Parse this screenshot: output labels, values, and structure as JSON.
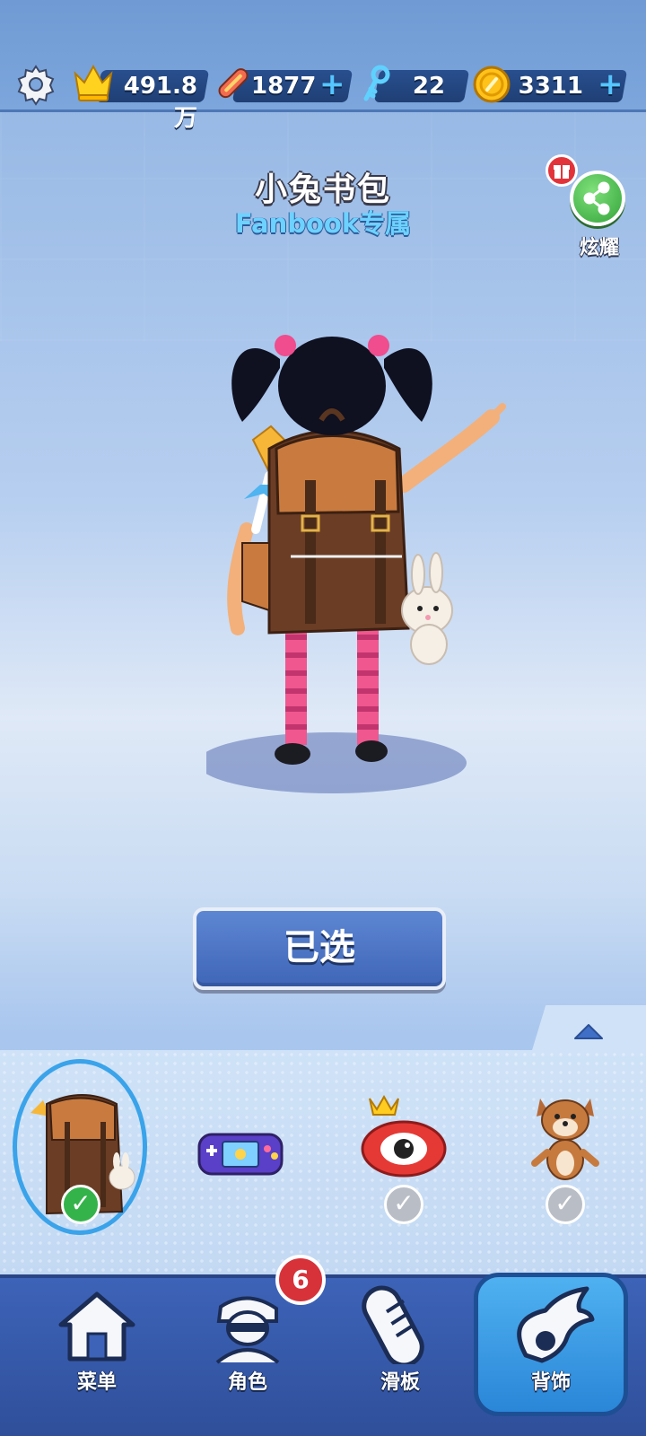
{
  "top_bar": {
    "crowns": "491.8万",
    "boards": "1877",
    "keys": "22",
    "coins": "3311",
    "plus": "+"
  },
  "item": {
    "name": "小兔书包",
    "subtitle": "Fanbook专属"
  },
  "share": {
    "label": "炫耀"
  },
  "select_button": {
    "label": "已选"
  },
  "items": [
    {
      "icon": "backpack-icon",
      "selected": true
    },
    {
      "icon": "game-console-icon",
      "selected": false
    },
    {
      "icon": "eye-mascot-icon",
      "selected": false
    },
    {
      "icon": "dog-mascot-icon",
      "selected": false
    }
  ],
  "nav": {
    "menu": "菜单",
    "character": "角色",
    "character_badge": "6",
    "board": "滑板",
    "backpack": "背饰"
  },
  "colors": {
    "accent_blue": "#3f66b8",
    "active_tab": "#2a86d8",
    "badge_red": "#d7323a",
    "check_green": "#34b34a"
  }
}
